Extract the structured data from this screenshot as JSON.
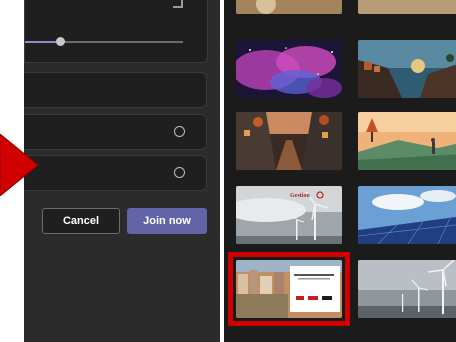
{
  "buttons": {
    "cancel_label": "Cancel",
    "join_label": "Join now"
  },
  "slider": {
    "value": 0.22
  },
  "options": [
    {
      "name": "option-row-1",
      "selected": false
    },
    {
      "name": "option-row-2",
      "selected": false
    },
    {
      "name": "option-row-3",
      "selected": false
    }
  ],
  "gallery": {
    "backgrounds": [
      {
        "name": "partial-top-left",
        "theme": "warm-landscape"
      },
      {
        "name": "partial-top-right",
        "theme": "warm-landscape"
      },
      {
        "name": "galaxy-nebula",
        "theme": "pink-purple-galaxy"
      },
      {
        "name": "cliffside-sunset",
        "theme": "fantasy-village-coast"
      },
      {
        "name": "village-street",
        "theme": "autumn-village-street"
      },
      {
        "name": "autumn-hills",
        "theme": "autumn-countryside"
      },
      {
        "name": "wind-turbines-logo",
        "theme": "wind-turbines-sky",
        "logo_text": "Gestion"
      },
      {
        "name": "solar-panels",
        "theme": "solar-panels-blue-sky"
      },
      {
        "name": "city-branding-card",
        "theme": "old-town-with-card",
        "selected": true
      },
      {
        "name": "wind-farm",
        "theme": "wind-turbines-grey-sky"
      }
    ]
  },
  "colors": {
    "accent": "#6264a7",
    "selection": "#d10000",
    "arrow": "#d10000",
    "panel": "#2b2b2b",
    "card": "#1f1f1f"
  }
}
